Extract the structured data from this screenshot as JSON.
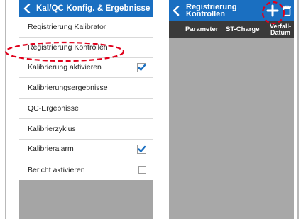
{
  "left_screen": {
    "title": "Kal/QC Konfig. & Ergebnisse",
    "items": [
      {
        "label": "Registrierung Kalibrator",
        "control": "none"
      },
      {
        "label": "Registrierung Kontrollen",
        "control": "none",
        "highlighted": true
      },
      {
        "label": "Kalibrierung aktivieren",
        "control": "checkbox",
        "checked": true
      },
      {
        "label": "Kalibrierungsergebnisse",
        "control": "none"
      },
      {
        "label": "QC-Ergebnisse",
        "control": "none"
      },
      {
        "label": "Kalibrierzyklus",
        "control": "none"
      },
      {
        "label": "Kalibrieralarm",
        "control": "checkbox",
        "checked": true
      },
      {
        "label": "Bericht aktivieren",
        "control": "checkbox",
        "checked": false
      }
    ]
  },
  "right_screen": {
    "title_line1": "Registrierung",
    "title_line2": "Kontrollen",
    "add_icon": "plus-icon",
    "delete_icon": "trash-icon",
    "table_headers": {
      "parameter": "Parameter",
      "charge": "ST-Charge",
      "date_line1": "Verfall-",
      "date_line2": "Datum"
    }
  },
  "colors": {
    "header_blue": "#1a6fc1",
    "table_header": "#3a3a3a",
    "empty_area": "#a5a5a5",
    "annotation_red": "#e0001b",
    "checkbox_blue": "#1a6fc1"
  }
}
